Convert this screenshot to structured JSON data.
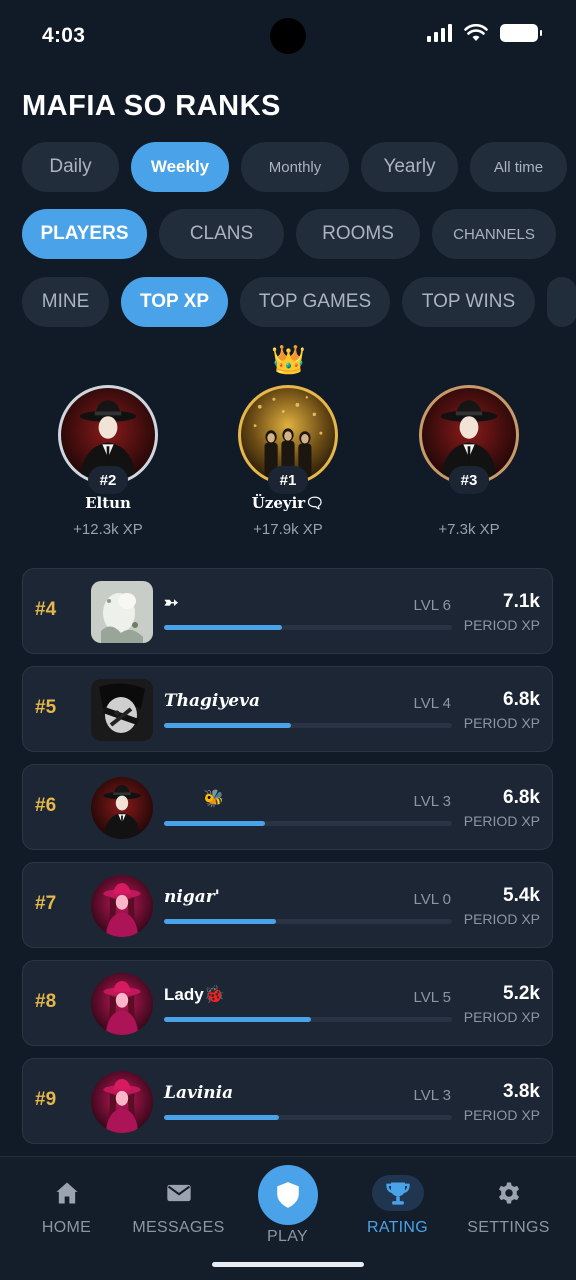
{
  "status_bar": {
    "time": "4:03"
  },
  "page_title": "MAFIA SO RANKS",
  "period_tabs": [
    {
      "label": "Daily",
      "active": false
    },
    {
      "label": "Weekly",
      "active": true
    },
    {
      "label": "Monthly",
      "active": false
    },
    {
      "label": "Yearly",
      "active": false
    },
    {
      "label": "All time",
      "active": false
    }
  ],
  "category_tabs": [
    {
      "label": "PLAYERS",
      "active": true
    },
    {
      "label": "CLANS",
      "active": false
    },
    {
      "label": "ROOMS",
      "active": false
    },
    {
      "label": "CHANNELS",
      "active": false
    }
  ],
  "metric_tabs": [
    {
      "label": "MINE",
      "active": false
    },
    {
      "label": "TOP XP",
      "active": true
    },
    {
      "label": "TOP GAMES",
      "active": false
    },
    {
      "label": "TOP WINS",
      "active": false
    }
  ],
  "podium": {
    "crown": "👑",
    "first": {
      "rank": "#1",
      "name": "Üzeyir🗨",
      "xp": "+17.9k XP"
    },
    "second": {
      "rank": "#2",
      "name": "Eltun",
      "xp": "+12.3k XP"
    },
    "third": {
      "rank": "#3",
      "name": "",
      "xp": "+7.3k XP"
    }
  },
  "rows": [
    {
      "rank": "#4",
      "name": "➳",
      "level": "LVL 6",
      "xp": "7.1k",
      "xp_label": "PERIOD XP",
      "progress": 0.41,
      "avatar": "photo-light"
    },
    {
      "rank": "#5",
      "name": "Thagiyeva",
      "level": "LVL 4",
      "xp": "6.8k",
      "xp_label": "PERIOD XP",
      "progress": 0.44,
      "avatar": "photo-dark"
    },
    {
      "rank": "#6",
      "name": "🐝",
      "level": "LVL 3",
      "xp": "6.8k",
      "xp_label": "PERIOD XP",
      "progress": 0.35,
      "avatar": "mafia-man"
    },
    {
      "rank": "#7",
      "name": "nigar'",
      "level": "LVL 0",
      "xp": "5.4k",
      "xp_label": "PERIOD XP",
      "progress": 0.39,
      "avatar": "mafia-woman"
    },
    {
      "rank": "#8",
      "name": "Lady🐞",
      "level": "LVL 5",
      "xp": "5.2k",
      "xp_label": "PERIOD XP",
      "progress": 0.51,
      "avatar": "mafia-woman"
    },
    {
      "rank": "#9",
      "name": "Lavinia",
      "level": "LVL 3",
      "xp": "3.8k",
      "xp_label": "PERIOD XP",
      "progress": 0.4,
      "avatar": "mafia-woman"
    }
  ],
  "bottom_nav": [
    {
      "label": "HOME",
      "icon": "home-icon",
      "active": false
    },
    {
      "label": "MESSAGES",
      "icon": "mail-icon",
      "active": false
    },
    {
      "label": "PLAY",
      "icon": "shield-icon",
      "active": false
    },
    {
      "label": "RATING",
      "icon": "trophy-icon",
      "active": true
    },
    {
      "label": "SETTINGS",
      "icon": "gear-icon",
      "active": false
    }
  ],
  "colors": {
    "accent": "#4aa3e8",
    "rank_gold": "#e6b74a",
    "background": "#111a27"
  }
}
